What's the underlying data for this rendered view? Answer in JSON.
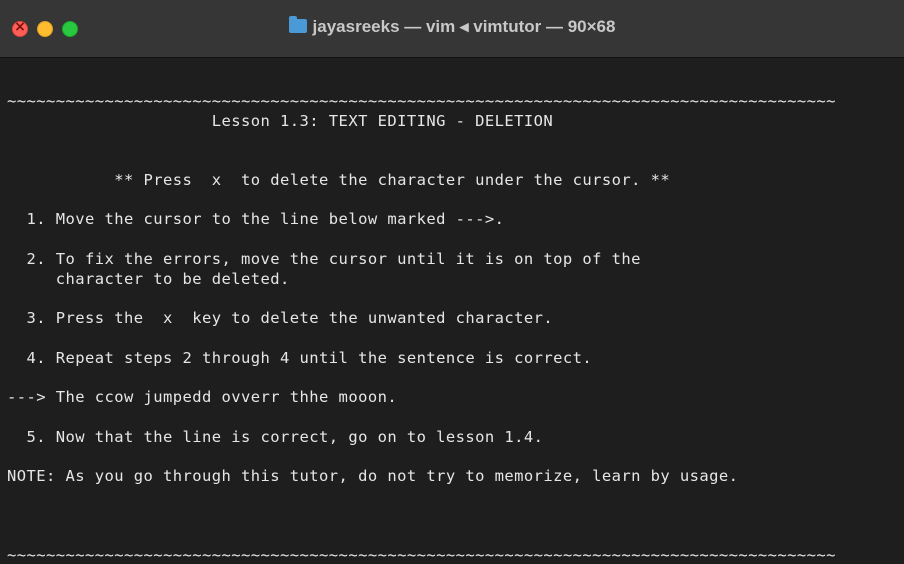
{
  "window": {
    "title": "jayasreeks — vim ◂ vimtutor — 90×68"
  },
  "terminal": {
    "separator": "~~~~~~~~~~~~~~~~~~~~~~~~~~~~~~~~~~~~~~~~~~~~~~~~~~~~~~~~~~~~~~~~~~~~~~~~~~~~~~~~~~~~~",
    "lesson_title": "                     Lesson 1.3: TEXT EDITING - DELETION",
    "intro": "           ** Press  x  to delete the character under the cursor. **",
    "step1": "  1. Move the cursor to the line below marked --->.",
    "step2a": "  2. To fix the errors, move the cursor until it is on top of the",
    "step2b": "     character to be deleted.",
    "step3": "  3. Press the  x  key to delete the unwanted character.",
    "step4": "  4. Repeat steps 2 through 4 until the sentence is correct.",
    "practice": "---> The ccow jumpedd ovverr thhe mooon.",
    "step5": "  5. Now that the line is correct, go on to lesson 1.4.",
    "note": "NOTE: As you go through this tutor, do not try to memorize, learn by usage.",
    "separator_bottom": "~~~~~~~~~~~~~~~~~~~~~~~~~~~~~~~~~~~~~~~~~~~~~~~~~~~~~~~~~~~~~~~~~~~~~~~~~~~~~~~~~~~~~"
  }
}
